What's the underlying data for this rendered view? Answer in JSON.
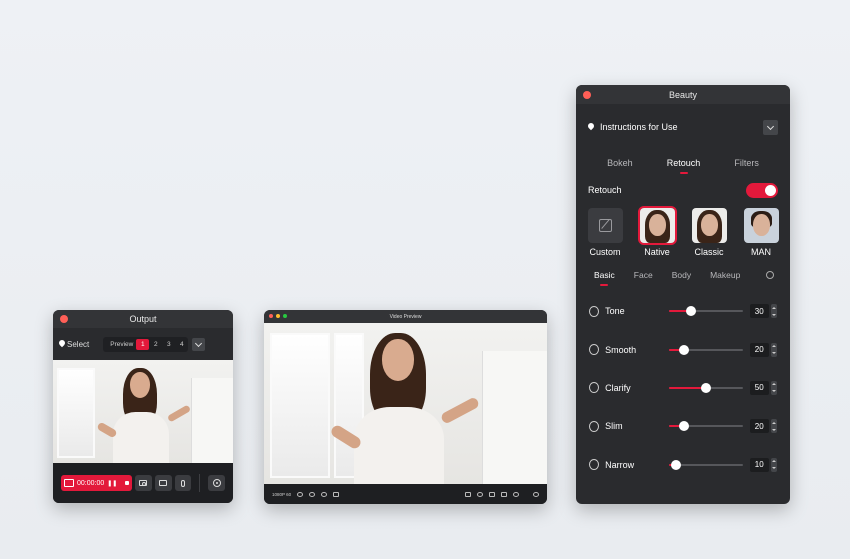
{
  "output": {
    "title": "Output",
    "select_label": "Select",
    "preview_label": "Preview",
    "pages": [
      "1",
      "2",
      "3",
      "4"
    ],
    "active_page": "1",
    "record_time": "00:00:00"
  },
  "video_preview": {
    "title": "Video Preview",
    "resolution": "1080P 60"
  },
  "beauty": {
    "title": "Beauty",
    "instructions_label": "Instructions for Use",
    "tabs": [
      "Bokeh",
      "Retouch",
      "Filters"
    ],
    "active_tab": "Retouch",
    "retouch_toggle_label": "Retouch",
    "retouch_enabled": true,
    "presets": [
      "Custom",
      "Native",
      "Classic",
      "MAN"
    ],
    "active_preset": "Native",
    "sub_tabs": [
      "Basic",
      "Face",
      "Body",
      "Makeup"
    ],
    "active_sub_tab": "Basic",
    "sliders": [
      {
        "label": "Tone",
        "value": "30",
        "fraction": 0.3
      },
      {
        "label": "Smooth",
        "value": "20",
        "fraction": 0.2
      },
      {
        "label": "Clarify",
        "value": "50",
        "fraction": 0.5
      },
      {
        "label": "Slim",
        "value": "20",
        "fraction": 0.2
      },
      {
        "label": "Narrow",
        "value": "10",
        "fraction": 0.1
      }
    ]
  },
  "colors": {
    "accent": "#e3193b",
    "panel": "#2a2b2e",
    "background": "#eceff3"
  }
}
